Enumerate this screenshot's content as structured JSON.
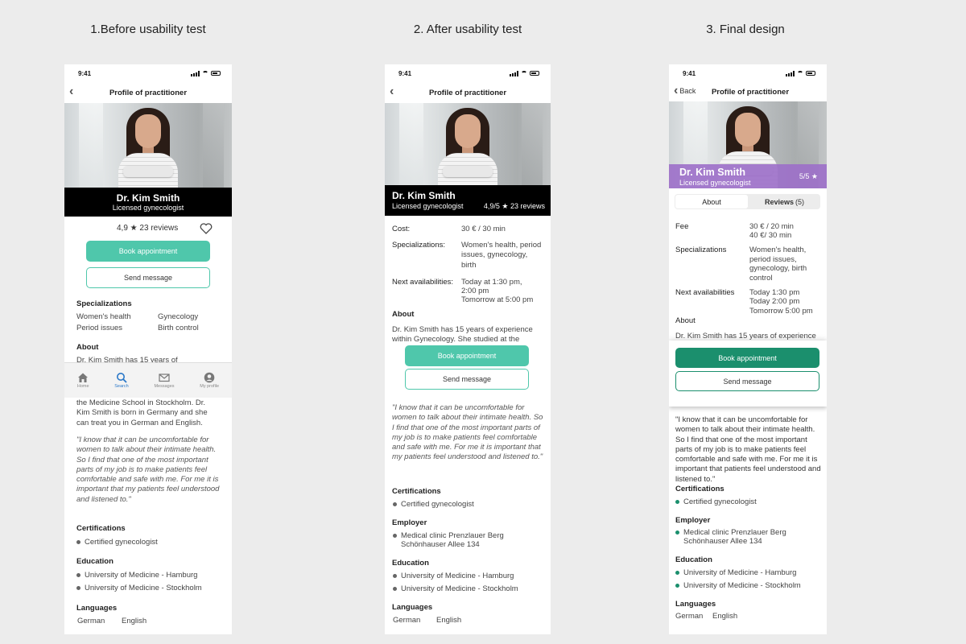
{
  "titles": {
    "c1": "1.Before usability test",
    "c2": "2. After usability test",
    "c3": "3. Final design"
  },
  "colors": {
    "teal": "#4fc7ab",
    "green": "#1b8f6d",
    "purple": "#9c6fc9"
  },
  "status_time": "9:41",
  "p1": {
    "nav_title": "Profile of practitioner",
    "name": "Dr. Kim Smith",
    "role": "Licensed gynecologist",
    "rating": "4,9 ★ 23 reviews",
    "book": "Book appointment",
    "message": "Send message",
    "spec_h": "Specializations",
    "spec": [
      "Women's health",
      "Gynecology",
      "Period issues",
      "Birth control"
    ],
    "about_h": "About",
    "about_cut": "Dr. Kim Smith has 15 years of",
    "about_rest": "the Medicine School in Stockholm. Dr. Kim Smith is born in Germany and she can treat you in German and English.",
    "quote": "\"I know that it can be uncomfortable for women to talk about their intimate health. So I find that one of the most important parts of my job is to make patients feel comfortable and safe with me. For me it is important that my patients feel understood and listened to.\"",
    "cert_h": "Certifications",
    "cert": "Certified gynecologist",
    "edu_h": "Education",
    "edu": [
      "University of Medicine - Hamburg",
      "University of Medicine - Stockholm"
    ],
    "lang_h": "Languages",
    "langs": [
      "German",
      "English"
    ],
    "tabs": [
      "Home",
      "Search",
      "Messages",
      "My profile"
    ]
  },
  "p2": {
    "nav_title": "Profile of practitioner",
    "name": "Dr. Kim Smith",
    "role": "Licensed gynecologist",
    "rating": "4,9/5 ★ 23 reviews",
    "cost_l": "Cost:",
    "cost": "30 € / 30 min",
    "spec_l": "Specializations:",
    "spec": "Women's health, period issues, gynecology, birth",
    "next_l": "Next availabilities:",
    "next": [
      "Today at 1:30 pm,",
      "2:00 pm",
      "Tomorrow at 5:00 pm"
    ],
    "about_h": "About",
    "about": "Dr. Kim Smith has 15 years of experience within Gynecology. She studied at the",
    "book": "Book appointment",
    "message": "Send message",
    "quote": "\"I know that it can be uncomfortable for women to talk about their intimate health. So I find that one of the most important parts of my job is to make patients feel comfortable and safe with me. For me it is important that my patients feel understood and listened to.\"",
    "cert_h": "Certifications",
    "cert": "Certified gynecologist",
    "emp_h": "Employer",
    "emp": [
      "Medical clinic Prenzlauer Berg",
      "Schönhauser Allee 134"
    ],
    "edu_h": "Education",
    "edu": [
      "University of Medicine - Hamburg",
      "University of Medicine - Stockholm"
    ],
    "lang_h": "Languages",
    "langs": [
      "German",
      "English"
    ]
  },
  "p3": {
    "back": "Back",
    "nav_title": "Profile of practitioner",
    "name": "Dr. Kim Smith",
    "role": "Licensed gynecologist",
    "rating": "5/5 ★",
    "tab_about": "About",
    "tab_reviews": "Reviews",
    "tab_reviews_count": "(5)",
    "fee_l": "Fee",
    "fee": [
      "30 € / 20 min",
      "40 €/ 30 min"
    ],
    "spec_l": "Specializations",
    "spec": [
      "Women's health,",
      "period issues,",
      "gynecology, birth",
      "control"
    ],
    "next_l": "Next availabilities",
    "next": [
      "Today 1:30 pm",
      "Today 2:00 pm",
      "Tomorrow 5:00 pm"
    ],
    "about_h": "About",
    "about": "Dr. Kim Smith has 15 years of experience",
    "book": "Book appointment",
    "message": "Send message",
    "quote": "\"I know that it can be uncomfortable for women to talk about their intimate health. So I find that one of the most important parts of my job is to make patients feel comfortable and safe with me. For me it is important that patients feel understood and listened to.\"",
    "cert_h": "Certifications",
    "cert": "Certified gynecologist",
    "emp_h": "Employer",
    "emp": [
      "Medical clinic Prenzlauer Berg",
      "Schönhauser Allee 134"
    ],
    "edu_h": "Education",
    "edu": [
      "University of Medicine - Hamburg",
      "University of Medicine - Stockholm"
    ],
    "lang_h": "Languages",
    "langs": [
      "German",
      "English"
    ]
  }
}
